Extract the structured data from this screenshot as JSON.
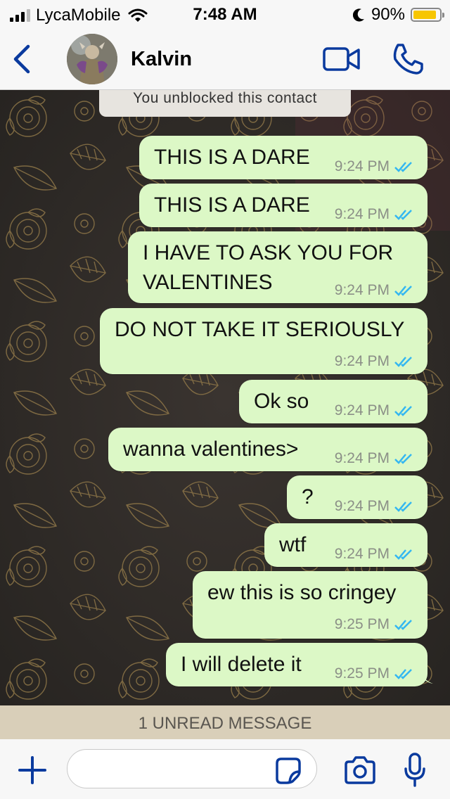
{
  "status_bar": {
    "carrier": "LycaMobile",
    "time": "7:48 AM",
    "battery": "90%",
    "battery_level": 0.9
  },
  "header": {
    "contact_name": "Kalvin"
  },
  "system_note": "You unblocked this contact",
  "messages": [
    {
      "text": "THIS IS A DARE",
      "time": "9:24 PM",
      "status": "read"
    },
    {
      "text": "THIS IS A DARE",
      "time": "9:24 PM",
      "status": "read"
    },
    {
      "text": "I HAVE TO ASK YOU FOR VALENTINES",
      "line1": "I HAVE TO ASK YOU FOR",
      "line2": "VALENTINES",
      "time": "9:24 PM",
      "status": "read"
    },
    {
      "text": "DO NOT TAKE IT SERIOUSLY",
      "time": "9:24 PM",
      "status": "read"
    },
    {
      "text": "Ok so",
      "time": "9:24 PM",
      "status": "read"
    },
    {
      "text": "wanna valentines>",
      "time": "9:24 PM",
      "status": "read"
    },
    {
      "text": "?",
      "time": "9:24 PM",
      "status": "read"
    },
    {
      "text": "wtf",
      "time": "9:24 PM",
      "status": "read"
    },
    {
      "text": "ew this is so cringey",
      "time": "9:25 PM",
      "status": "read"
    },
    {
      "text": "I will delete it",
      "time": "9:25 PM",
      "status": "read"
    }
  ],
  "unread_banner": "1 UNREAD MESSAGE",
  "input": {
    "value": "",
    "placeholder": ""
  },
  "colors": {
    "accent": "#0a3a9e",
    "bubble": "#dcf8c6",
    "read_ticks": "#34b7f1",
    "battery": "#f7c600"
  },
  "icons": [
    "back-chevron-icon",
    "video-call-icon",
    "phone-icon",
    "plus-icon",
    "sticker-icon",
    "camera-icon",
    "microphone-icon",
    "wifi-icon",
    "moon-icon"
  ]
}
